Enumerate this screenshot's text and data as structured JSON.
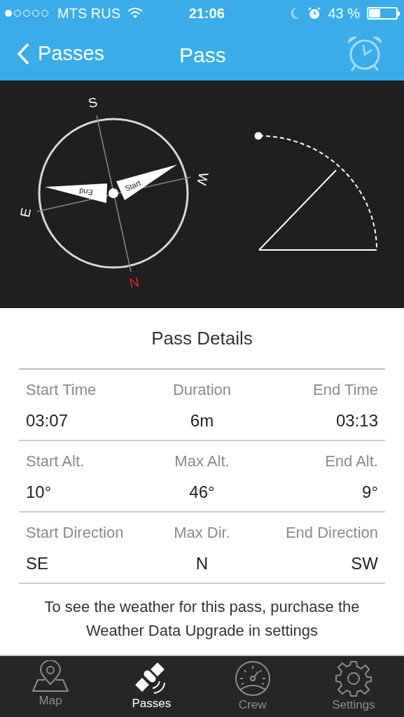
{
  "status_bar": {
    "carrier": "MTS RUS",
    "time": "21:06",
    "battery": "43 %"
  },
  "nav": {
    "back": "Passes",
    "title": "Pass"
  },
  "compass": {
    "directions": [
      {
        "kind": "s",
        "label": "S"
      },
      {
        "kind": "w",
        "label": "W"
      },
      {
        "kind": "e",
        "label": "E"
      },
      {
        "kind": "n",
        "label": "N"
      }
    ],
    "needles": [
      {
        "kind": "start",
        "label": "Start"
      },
      {
        "kind": "end",
        "label": "End"
      }
    ]
  },
  "details": {
    "title": "Pass Details",
    "rows": [
      [
        {
          "label": "Start Time",
          "value": "03:07"
        },
        {
          "label": "Duration",
          "value": "6m"
        },
        {
          "label": "End Time",
          "value": "03:13"
        }
      ],
      [
        {
          "label": "Start Alt.",
          "value": "10°"
        },
        {
          "label": "Max Alt.",
          "value": "46°"
        },
        {
          "label": "End Alt.",
          "value": "9°"
        }
      ],
      [
        {
          "label": "Start Direction",
          "value": "SE"
        },
        {
          "label": "Max Dir.",
          "value": "N"
        },
        {
          "label": "End Direction",
          "value": "SW"
        }
      ]
    ],
    "note": "To see the weather for this pass, purchase the Weather Data Upgrade in settings"
  },
  "tabs": [
    {
      "kind": "map",
      "label": "Map",
      "selected": false
    },
    {
      "kind": "passes",
      "label": "Passes",
      "selected": true
    },
    {
      "kind": "crew",
      "label": "Crew",
      "selected": false
    },
    {
      "kind": "settings",
      "label": "Settings",
      "selected": false
    }
  ]
}
